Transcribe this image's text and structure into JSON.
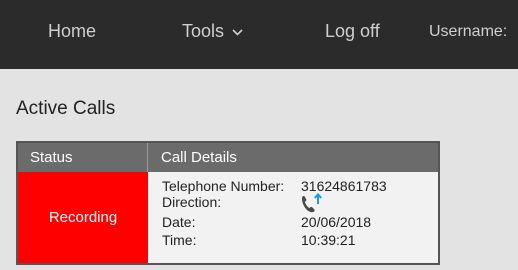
{
  "nav": {
    "home": "Home",
    "tools": "Tools",
    "logoff": "Log off",
    "username": "Username:"
  },
  "page": {
    "title": "Active Calls"
  },
  "table": {
    "headers": [
      "Status",
      "Call Details"
    ],
    "rows": [
      {
        "status": "Recording",
        "status_color": "#ff0000",
        "details": {
          "telephone_label": "Telephone Number:",
          "telephone_value": "31624861783",
          "direction_label": "Direction:",
          "direction_icon": "outgoing-call-icon",
          "date_label": "Date:",
          "date_value": "20/06/2018",
          "time_label": "Time:",
          "time_value": "10:39:21"
        }
      }
    ]
  },
  "colors": {
    "navbar_bg": "#2b2b2b",
    "header_bg": "#6b6b6b",
    "arrow_blue": "#1a9be6"
  }
}
